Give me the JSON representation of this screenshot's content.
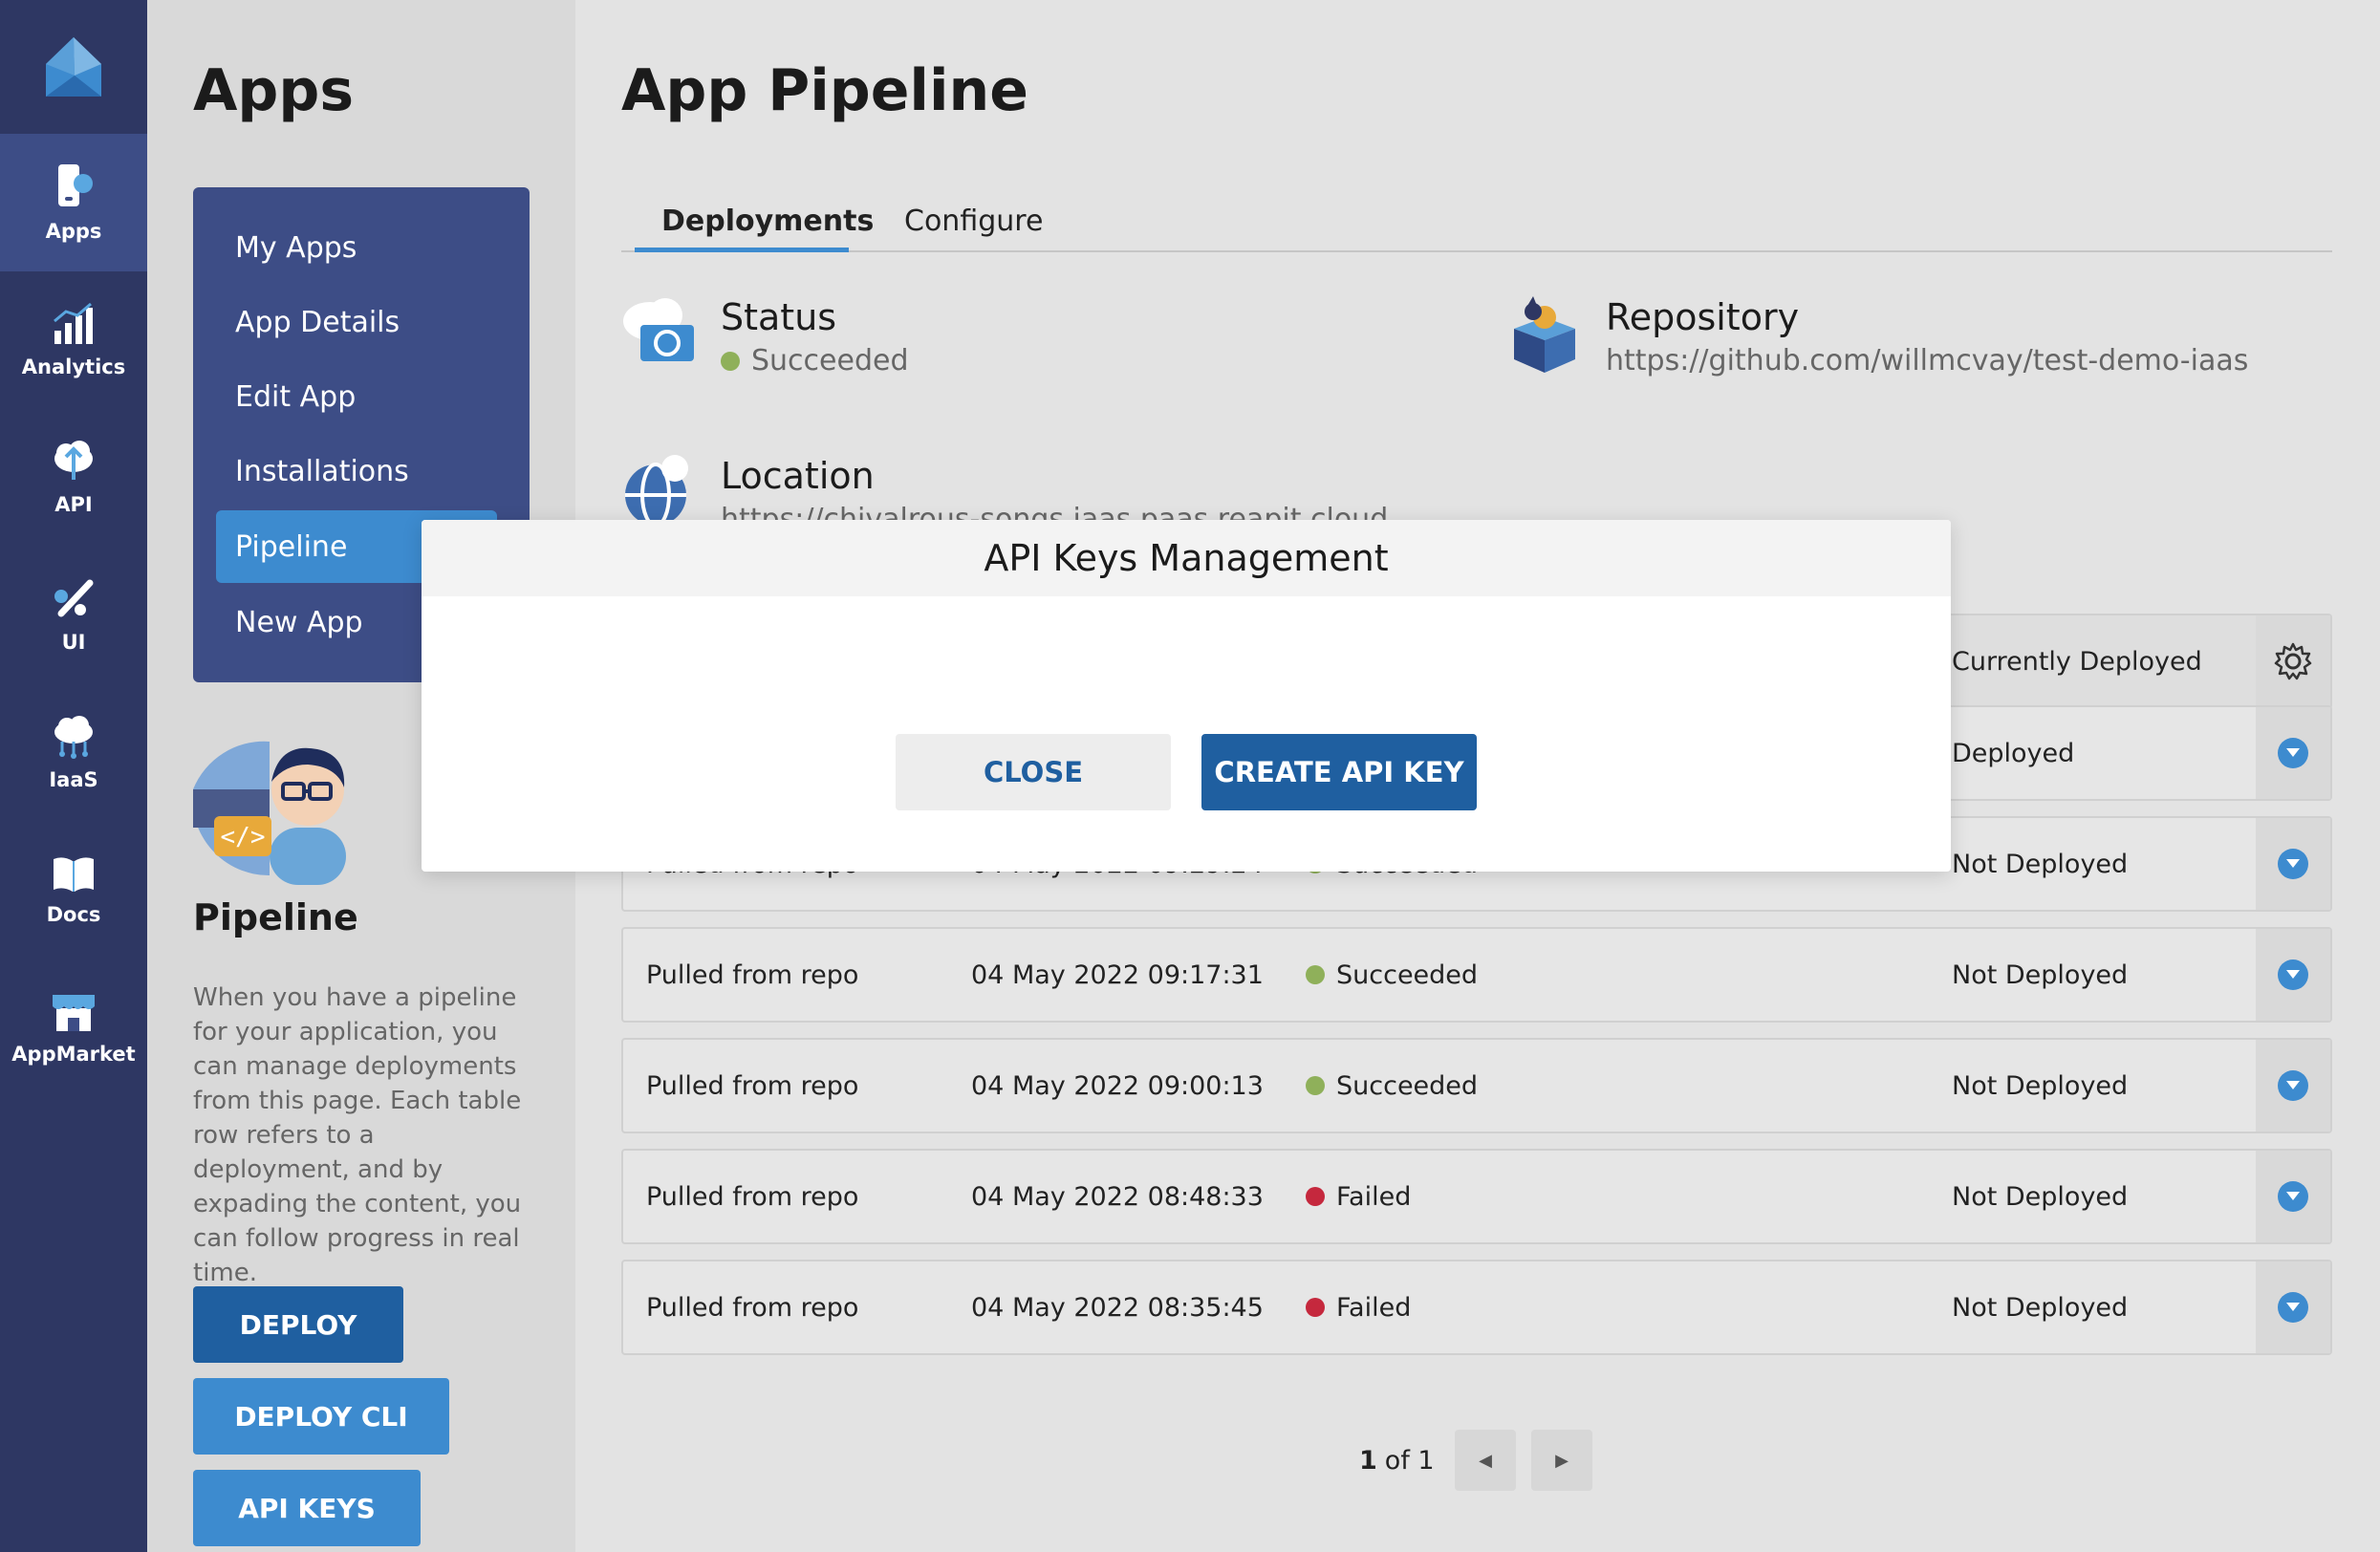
{
  "rail": {
    "items": [
      {
        "label": "Apps",
        "icon": "apps-icon"
      },
      {
        "label": "Analytics",
        "icon": "analytics-icon"
      },
      {
        "label": "API",
        "icon": "api-icon"
      },
      {
        "label": "UI",
        "icon": "ui-icon"
      },
      {
        "label": "IaaS",
        "icon": "iaas-icon"
      },
      {
        "label": "Docs",
        "icon": "docs-icon"
      },
      {
        "label": "AppMarket",
        "icon": "appmarket-icon"
      }
    ]
  },
  "sidebar": {
    "title": "Apps",
    "menu": [
      "My Apps",
      "App Details",
      "Edit App",
      "Installations",
      "Pipeline",
      "New App"
    ],
    "section_title": "Pipeline",
    "description": "When you have a pipeline for your application, you can manage deployments from this page. Each table row refers to a deployment, and by expading the content, you can follow progress in real time.",
    "buttons": {
      "deploy": "DEPLOY",
      "deploy_cli": "DEPLOY CLI",
      "api_keys": "API KEYS"
    }
  },
  "main": {
    "title": "App Pipeline",
    "tabs": [
      "Deployments",
      "Configure"
    ],
    "status": {
      "label": "Status",
      "value": "Succeeded"
    },
    "repository": {
      "label": "Repository",
      "value": "https://github.com/willmcvay/test-demo-iaas"
    },
    "location": {
      "label": "Location",
      "value": "https://chivalrous-songs.iaas.paas.reapit.cloud"
    },
    "header_cell": "Currently Deployed",
    "rows": [
      {
        "source": "",
        "date": "",
        "status": "",
        "deployed": "Deployed"
      },
      {
        "source": "Pulled from repo",
        "date": "04 May 2022 09:29:24",
        "status": "Succeeded",
        "deployed": "Not Deployed"
      },
      {
        "source": "Pulled from repo",
        "date": "04 May 2022 09:17:31",
        "status": "Succeeded",
        "deployed": "Not Deployed"
      },
      {
        "source": "Pulled from repo",
        "date": "04 May 2022 09:00:13",
        "status": "Succeeded",
        "deployed": "Not Deployed"
      },
      {
        "source": "Pulled from repo",
        "date": "04 May 2022 08:48:33",
        "status": "Failed",
        "deployed": "Not Deployed"
      },
      {
        "source": "Pulled from repo",
        "date": "04 May 2022 08:35:45",
        "status": "Failed",
        "deployed": "Not Deployed"
      }
    ],
    "pager": {
      "current": "1",
      "of_text": "of 1"
    }
  },
  "modal": {
    "title": "API Keys Management",
    "close_label": "CLOSE",
    "create_label": "CREATE API KEY"
  },
  "colors": {
    "rail": "#2e3763",
    "accent": "#3d8bcf",
    "primary_dark": "#1f5fa0",
    "success": "#8fb05a",
    "failed": "#c5283d"
  }
}
